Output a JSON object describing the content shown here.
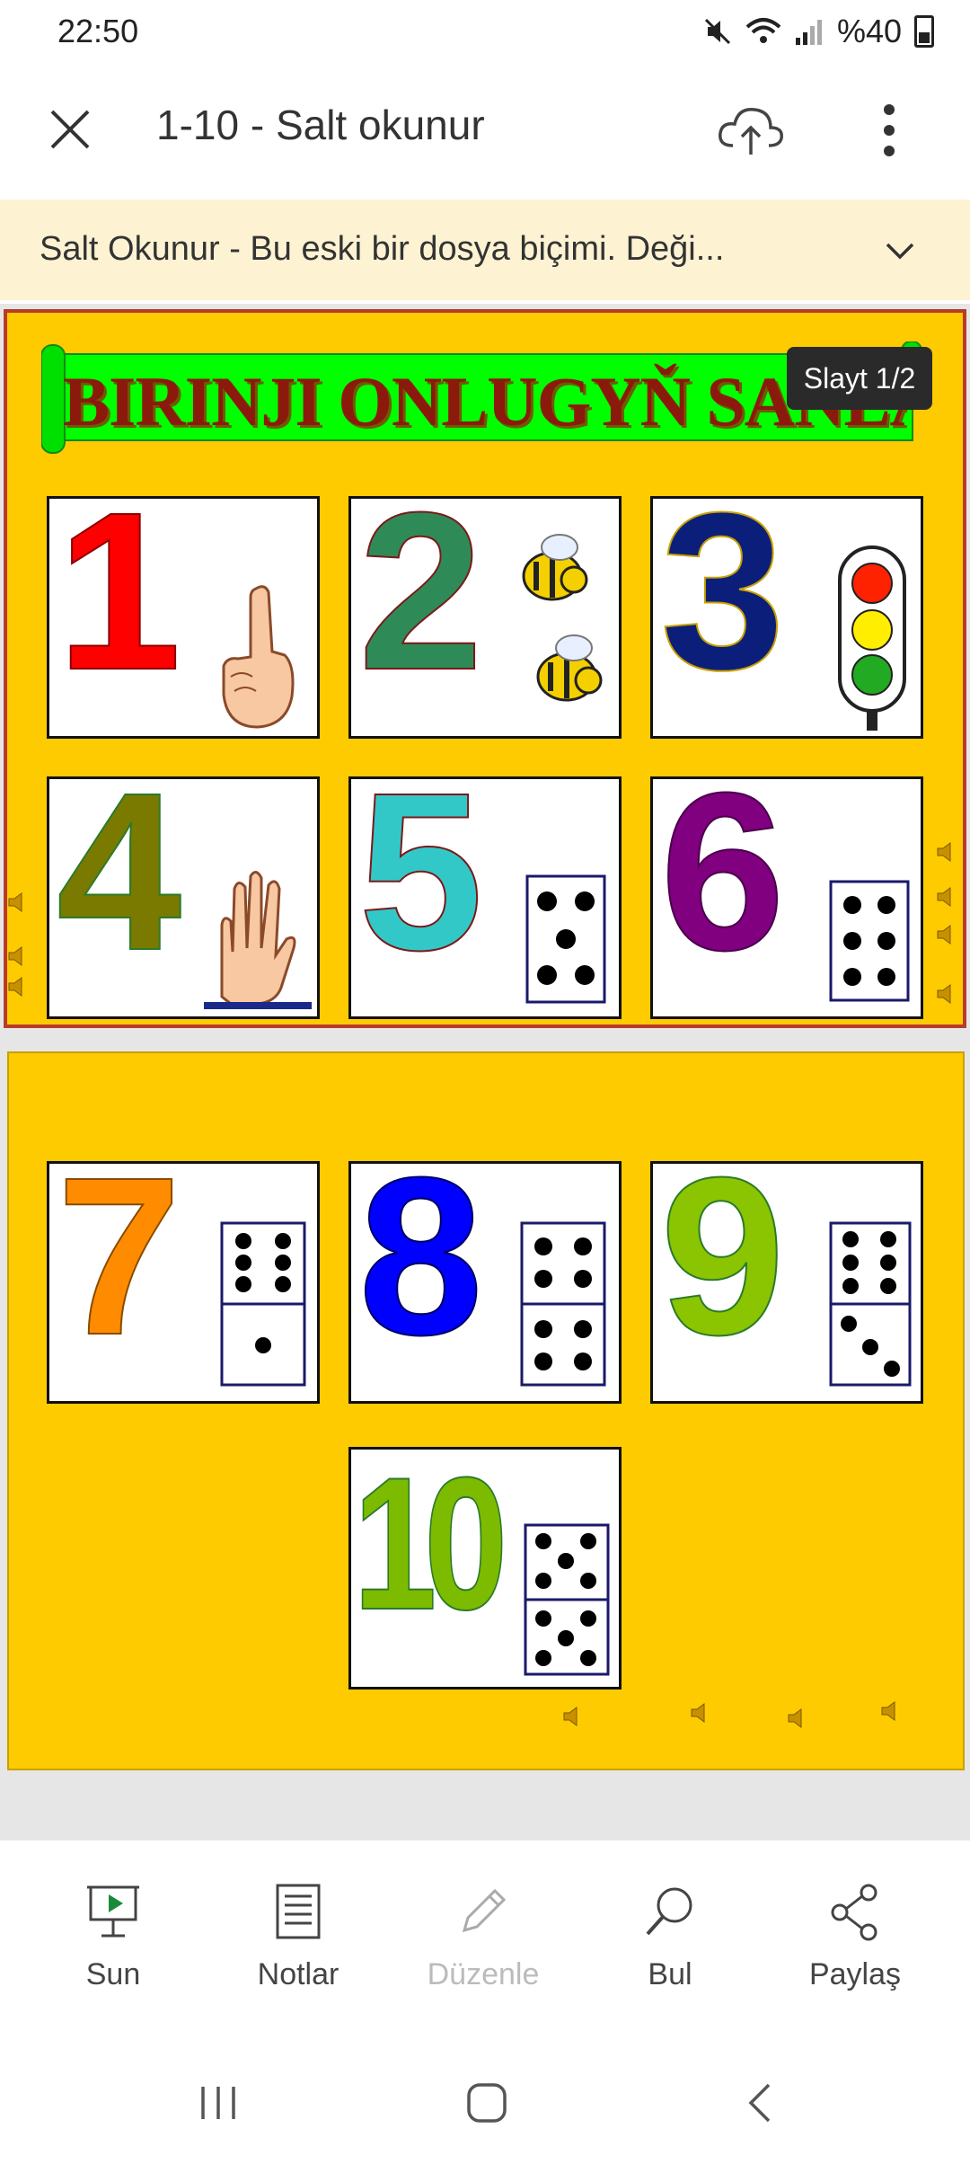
{
  "status_bar": {
    "time": "22:50",
    "battery": "%40"
  },
  "toolbar": {
    "title": "1-10 - Salt okunur"
  },
  "banner": {
    "text": "Salt Okunur - Bu eski bir dosya biçimi. Deği..."
  },
  "slide1": {
    "badge": "Slayt 1/2",
    "title": "BIRINJI ONLUGYŇ SANLARY",
    "cards": [
      {
        "number": "1",
        "color": "#ff0000",
        "picture": "hand-one-finger"
      },
      {
        "number": "2",
        "color": "#2e8b57",
        "picture": "two-bees"
      },
      {
        "number": "3",
        "color": "#0b1f7a",
        "picture": "traffic-light"
      },
      {
        "number": "4",
        "color": "#7a7a00",
        "picture": "hand-four-fingers"
      },
      {
        "number": "5",
        "color": "#33c8c8",
        "picture": "dice-five"
      },
      {
        "number": "6",
        "color": "#800080",
        "picture": "dice-six"
      }
    ]
  },
  "slide2": {
    "cards": [
      {
        "number": "7",
        "color": "#ff8c00",
        "picture": "domino-6-1"
      },
      {
        "number": "8",
        "color": "#0000ff",
        "picture": "domino-4-4"
      },
      {
        "number": "9",
        "color": "#8bc400",
        "picture": "domino-6-3"
      },
      {
        "number": "10",
        "color": "#7dbb00",
        "picture": "domino-5-5"
      }
    ]
  },
  "bottom_bar": {
    "items": [
      {
        "label": "Sun",
        "icon": "present-icon"
      },
      {
        "label": "Notlar",
        "icon": "notes-icon"
      },
      {
        "label": "Düzenle",
        "icon": "pencil-icon"
      },
      {
        "label": "Bul",
        "icon": "search-icon"
      },
      {
        "label": "Paylaş",
        "icon": "share-icon"
      }
    ]
  }
}
